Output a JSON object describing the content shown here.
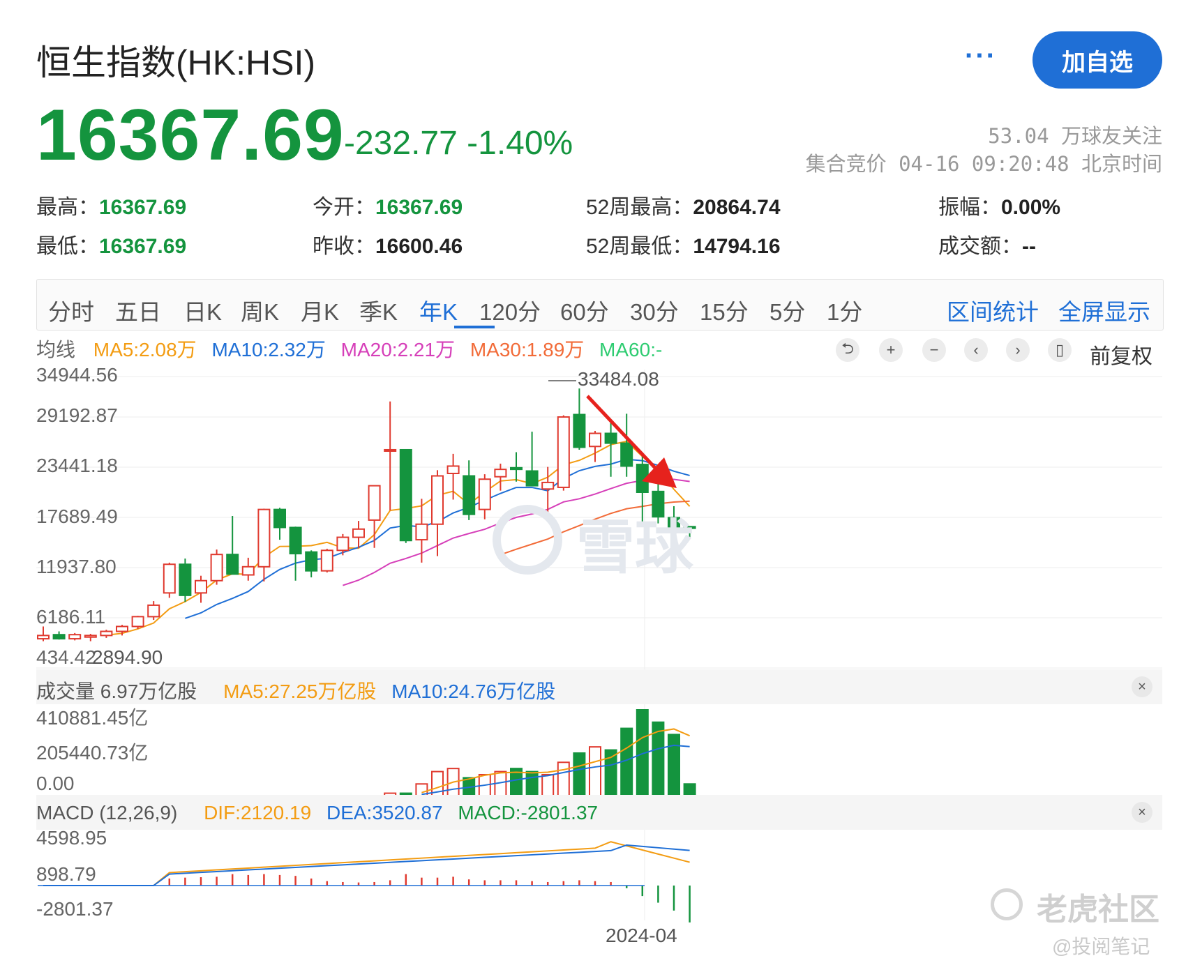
{
  "header": {
    "title": "恒生指数(HK:HSI)",
    "more_label": "···",
    "add_button": "加自选",
    "price": "16367.69",
    "change": "-232.77 -1.40%",
    "followers": "53.04 万球友关注",
    "status": "集合竞价 04-16 09:20:48 北京时间"
  },
  "stats": [
    {
      "label": "最高：",
      "value": "16367.69"
    },
    {
      "label": "今开：",
      "value": "16367.69"
    },
    {
      "label": "52周最高：",
      "value": "20864.74"
    },
    {
      "label": "振幅：",
      "value": "0.00%"
    },
    {
      "label": "最低：",
      "value": "16367.69"
    },
    {
      "label": "昨收：",
      "value": "16600.46"
    },
    {
      "label": "52周最低：",
      "value": "14794.16"
    },
    {
      "label": "成交额：",
      "value": "--"
    }
  ],
  "tabs": [
    "分时",
    "五日",
    "日K",
    "周K",
    "月K",
    "季K",
    "年K",
    "120分",
    "60分",
    "30分",
    "15分",
    "5分",
    "1分"
  ],
  "active_tab": "年K",
  "right_links": [
    "区间统计",
    "全屏显示"
  ],
  "ma_legend": {
    "label": "均线",
    "items": [
      {
        "text": "MA5:2.08万",
        "color": "#f39c12"
      },
      {
        "text": "MA10:2.32万",
        "color": "#1f6fd6"
      },
      {
        "text": "MA20:2.21万",
        "color": "#d63fb9"
      },
      {
        "text": "MA30:1.89万",
        "color": "#f26b38"
      },
      {
        "text": "MA60:-",
        "color": "#2ecc71"
      }
    ]
  },
  "controls": {
    "icons": [
      "undo-icon",
      "zoom-in-icon",
      "zoom-out-icon",
      "chevron-left-icon",
      "chevron-right-icon",
      "candle-icon"
    ],
    "glyphs": [
      "⮌",
      "+",
      "−",
      "‹",
      "›",
      "▯"
    ],
    "adjust_label": "前复权"
  },
  "volume_legend": {
    "label": "成交量 6.97万亿股",
    "items": [
      {
        "text": "MA5:27.25万亿股",
        "color": "#f39c12"
      },
      {
        "text": "MA10:24.76万亿股",
        "color": "#1f6fd6"
      }
    ]
  },
  "macd_legend": {
    "label": "MACD (12,26,9)",
    "items": [
      {
        "text": "DIF:2120.19",
        "color": "#f39c12"
      },
      {
        "text": "DEA:3520.87",
        "color": "#1f6fd6"
      },
      {
        "text": "MACD:-2801.37",
        "color": "#14943e"
      }
    ]
  },
  "close_label": "×",
  "watermarks": {
    "xueqiu": "雪球",
    "tiger": "老虎社区",
    "author": "@投阅笔记"
  },
  "colors": {
    "up": "#e03a2f",
    "down": "#14943e",
    "accent": "#1f6fd6"
  },
  "chart_data": {
    "type": "candlestick",
    "price_axis": {
      "ticks": [
        "34944.56",
        "29192.87",
        "23441.18",
        "17689.49",
        "11937.80",
        "6186.11",
        "434.42"
      ],
      "range": [
        434.42,
        34944.56
      ]
    },
    "annotations": {
      "max": "33484.08",
      "min": "2894.90"
    },
    "x_label": "2024-04",
    "candles": [
      {
        "o": 2900,
        "h": 4400,
        "l": 2600,
        "c": 3300
      },
      {
        "o": 3400,
        "h": 3800,
        "l": 2800,
        "c": 2900
      },
      {
        "o": 2900,
        "h": 3600,
        "l": 2700,
        "c": 3400
      },
      {
        "o": 3100,
        "h": 3500,
        "l": 2600,
        "c": 3300
      },
      {
        "o": 3300,
        "h": 4000,
        "l": 3000,
        "c": 3800
      },
      {
        "o": 3800,
        "h": 4600,
        "l": 3300,
        "c": 4400
      },
      {
        "o": 4400,
        "h": 5700,
        "l": 4100,
        "c": 5600
      },
      {
        "o": 5600,
        "h": 7500,
        "l": 5200,
        "c": 7000
      },
      {
        "o": 8500,
        "h": 12200,
        "l": 7900,
        "c": 12000
      },
      {
        "o": 12000,
        "h": 12700,
        "l": 7400,
        "c": 8200
      },
      {
        "o": 8500,
        "h": 10600,
        "l": 7300,
        "c": 10000
      },
      {
        "o": 10000,
        "h": 13800,
        "l": 9500,
        "c": 13200
      },
      {
        "o": 13200,
        "h": 17900,
        "l": 10800,
        "c": 10800
      },
      {
        "o": 10700,
        "h": 12800,
        "l": 10000,
        "c": 11700
      },
      {
        "o": 11700,
        "h": 18800,
        "l": 9900,
        "c": 18700
      },
      {
        "o": 18700,
        "h": 18900,
        "l": 15000,
        "c": 16500
      },
      {
        "o": 16500,
        "h": 16600,
        "l": 10000,
        "c": 13300
      },
      {
        "o": 13500,
        "h": 13700,
        "l": 10400,
        "c": 11200
      },
      {
        "o": 11200,
        "h": 13900,
        "l": 11000,
        "c": 13700
      },
      {
        "o": 13700,
        "h": 15700,
        "l": 13100,
        "c": 15300
      },
      {
        "o": 15300,
        "h": 17300,
        "l": 14000,
        "c": 16300
      },
      {
        "o": 17400,
        "h": 20800,
        "l": 14000,
        "c": 21600
      },
      {
        "o": 26000,
        "h": 31900,
        "l": 18600,
        "c": 26000
      },
      {
        "o": 26000,
        "h": 26000,
        "l": 14600,
        "c": 14900
      },
      {
        "o": 15000,
        "h": 20000,
        "l": 12200,
        "c": 16900
      },
      {
        "o": 16900,
        "h": 23500,
        "l": 13000,
        "c": 22800
      },
      {
        "o": 23100,
        "h": 25500,
        "l": 19900,
        "c": 24000
      },
      {
        "o": 22800,
        "h": 24700,
        "l": 17400,
        "c": 18100
      },
      {
        "o": 18700,
        "h": 23000,
        "l": 17500,
        "c": 22400
      },
      {
        "o": 22700,
        "h": 24300,
        "l": 21000,
        "c": 23600
      },
      {
        "o": 23800,
        "h": 25700,
        "l": 22100,
        "c": 23600
      },
      {
        "o": 23400,
        "h": 28200,
        "l": 22000,
        "c": 21600
      },
      {
        "o": 21200,
        "h": 23900,
        "l": 17300,
        "c": 22000
      },
      {
        "o": 21400,
        "h": 30200,
        "l": 21000,
        "c": 30000
      },
      {
        "o": 30300,
        "h": 33484,
        "l": 26000,
        "c": 26300
      },
      {
        "o": 26400,
        "h": 28300,
        "l": 24500,
        "c": 28000
      },
      {
        "o": 28000,
        "h": 29500,
        "l": 22700,
        "c": 26800
      },
      {
        "o": 26800,
        "h": 30400,
        "l": 22700,
        "c": 24000
      },
      {
        "o": 24200,
        "h": 25700,
        "l": 16600,
        "c": 20800
      },
      {
        "o": 20900,
        "h": 22800,
        "l": 17000,
        "c": 17800
      },
      {
        "o": 17700,
        "h": 19100,
        "l": 14800,
        "c": 16400
      },
      {
        "o": 16600,
        "h": 16600,
        "l": 15300,
        "c": 16400
      }
    ]
  }
}
